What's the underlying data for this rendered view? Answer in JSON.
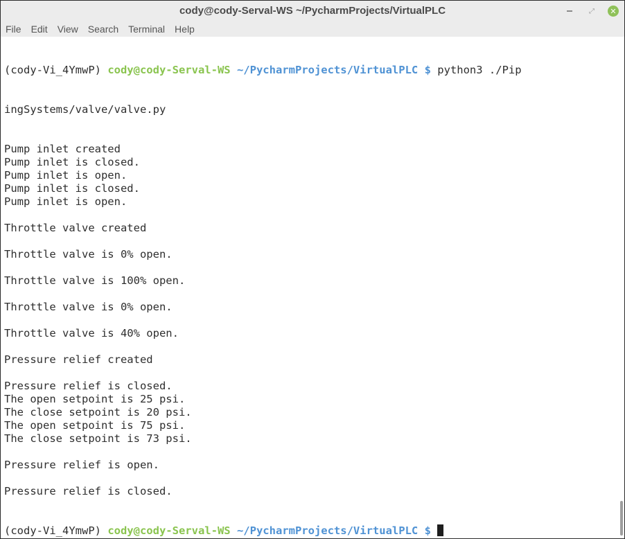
{
  "window": {
    "title": "cody@cody-Serval-WS ~/PycharmProjects/VirtualPLC",
    "minimize_symbol": "",
    "maximize_symbol": "⤢",
    "close_symbol": "✕"
  },
  "menu": {
    "items": [
      "File",
      "Edit",
      "View",
      "Search",
      "Terminal",
      "Help"
    ]
  },
  "prompt": {
    "env": "(cody-Vi_4YmwP) ",
    "user_host": "cody@cody-Serval-WS",
    "path": " ~/PycharmProjects/VirtualPLC",
    "dollar": " $",
    "command": " python3 ./Pip",
    "command_wrap": "ingSystems/valve/valve.py"
  },
  "output": {
    "lines": [
      "Pump inlet created",
      "Pump inlet is closed.",
      "Pump inlet is open.",
      "Pump inlet is closed.",
      "Pump inlet is open.",
      "",
      "Throttle valve created",
      "",
      "Throttle valve is 0% open.",
      "",
      "Throttle valve is 100% open.",
      "",
      "Throttle valve is 0% open.",
      "",
      "Throttle valve is 40% open.",
      "",
      "Pressure relief created",
      "",
      "Pressure relief is closed.",
      "The open setpoint is 25 psi.",
      "The close setpoint is 20 psi.",
      "The open setpoint is 75 psi.",
      "The close setpoint is 73 psi.",
      "",
      "Pressure relief is open.",
      "",
      "Pressure relief is closed."
    ]
  },
  "colors": {
    "user_host": "#8ac44f",
    "path": "#4f92d4",
    "close_button": "#8fc159"
  }
}
